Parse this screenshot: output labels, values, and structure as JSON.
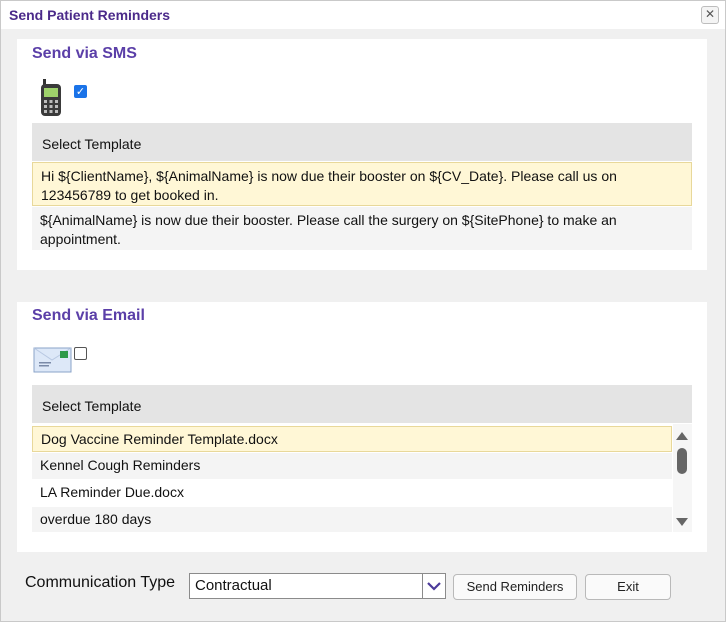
{
  "window": {
    "title": "Send Patient Reminders",
    "close_icon": "close-icon"
  },
  "sms": {
    "title": "Send via SMS",
    "icon": "mobile-phone-icon",
    "checked": true,
    "template_header": "Select Template",
    "templates": [
      {
        "text": "Hi ${ClientName}, ${AnimalName} is now due their booster on ${CV_Date}. Please call us on 123456789 to get booked in.",
        "selected": true
      },
      {
        "text": "${AnimalName} is now due their booster. Please call the surgery on ${SitePhone} to make an appointment.",
        "selected": false
      }
    ]
  },
  "email": {
    "title": "Send via Email",
    "icon": "email-envelope-icon",
    "checked": false,
    "template_header": "Select Template",
    "templates": [
      {
        "text": "Dog Vaccine Reminder Template.docx",
        "selected": true
      },
      {
        "text": "Kennel Cough Reminders",
        "selected": false
      },
      {
        "text": "LA Reminder Due.docx",
        "selected": false
      },
      {
        "text": "overdue 180 days",
        "selected": false
      }
    ]
  },
  "footer": {
    "communication_type_label": "Communication Type",
    "communication_type_value": "Contractual",
    "send_button": "Send Reminders",
    "exit_button": "Exit"
  }
}
